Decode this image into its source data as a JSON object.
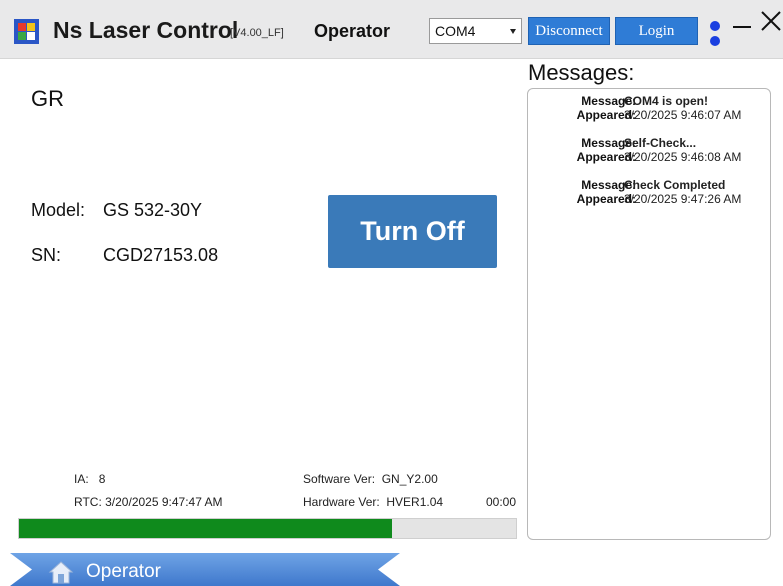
{
  "titlebar": {
    "app_title": "Ns Laser Control",
    "version": "[V4.00_LF]",
    "role": "Operator",
    "com_port": "COM4",
    "disconnect_label": "Disconnect",
    "login_label": "Login",
    "minimize_icon": "minimize-icon",
    "close_icon": "close-icon"
  },
  "main": {
    "model_name": "GR",
    "model_label": "Model:",
    "model_value": "GS 532-30Y",
    "sn_label": "SN:",
    "sn_value": "CGD27153.08",
    "turn_off_label": "Turn Off"
  },
  "info": {
    "ia_label": "IA:",
    "ia_value": "8",
    "rtc_label": "RTC:",
    "rtc_value": "3/20/2025 9:47:47 AM",
    "software_label": "Software Ver:",
    "software_value": "GN_Y2.00",
    "hardware_label": "Hardware Ver:",
    "hardware_value": "HVER1.04",
    "timer": "00:00",
    "progress_fraction": 0.75
  },
  "messages": {
    "title": "Messages:",
    "message_label": "Message:",
    "appeared_label": "Appeared:",
    "items": [
      {
        "message": "COM4 is open!",
        "appeared": "3/20/2025 9:46:07 AM"
      },
      {
        "message": "Self-Check...",
        "appeared": "3/20/2025 9:46:08 AM"
      },
      {
        "message": "Check Completed",
        "appeared": "3/20/2025 9:47:26 AM"
      }
    ]
  },
  "nav": {
    "operator_label": "Operator",
    "home_icon": "home-icon"
  },
  "colors": {
    "accent": "#2f7cd6",
    "turn_off": "#3a7ab9",
    "progress": "#0f8a1c",
    "nav": "#4a86d8",
    "status_dots": "#1a3fe0"
  }
}
